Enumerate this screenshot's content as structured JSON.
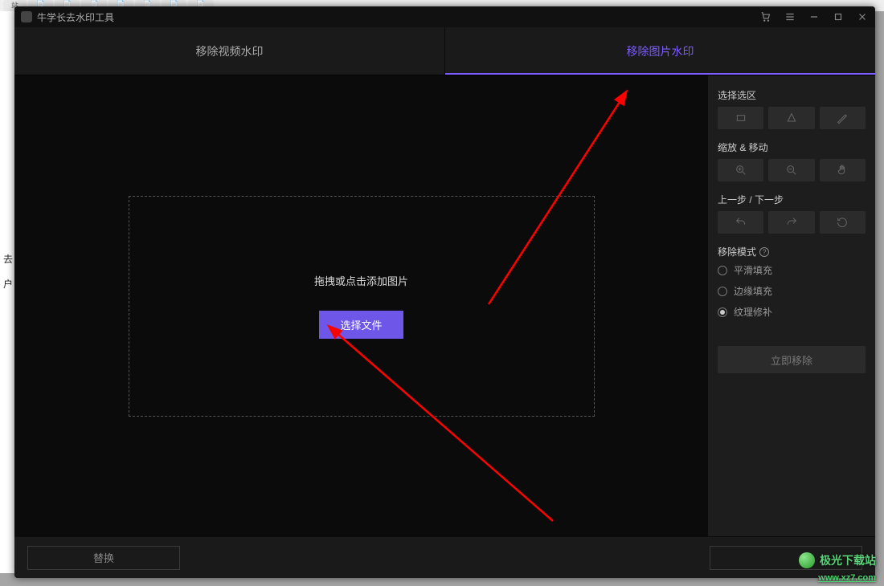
{
  "window": {
    "title": "牛学长去水印工具"
  },
  "tabs": {
    "video": "移除视频水印",
    "image": "移除图片水印"
  },
  "dropzone": {
    "hint": "拖拽或点击添加图片",
    "button": "选择文件"
  },
  "sidebar": {
    "selection_label": "选择选区",
    "zoom_label": "缩放 & 移动",
    "history_label": "上一步 / 下一步",
    "mode_label": "移除模式",
    "modes": {
      "smooth": "平滑填充",
      "edge": "边缘填充",
      "texture": "纹理修补"
    },
    "remove_now": "立即移除"
  },
  "footer": {
    "replace": "替换",
    "export": ""
  },
  "watermark": {
    "name": "极光下载站",
    "url": "www.xz7.com"
  }
}
